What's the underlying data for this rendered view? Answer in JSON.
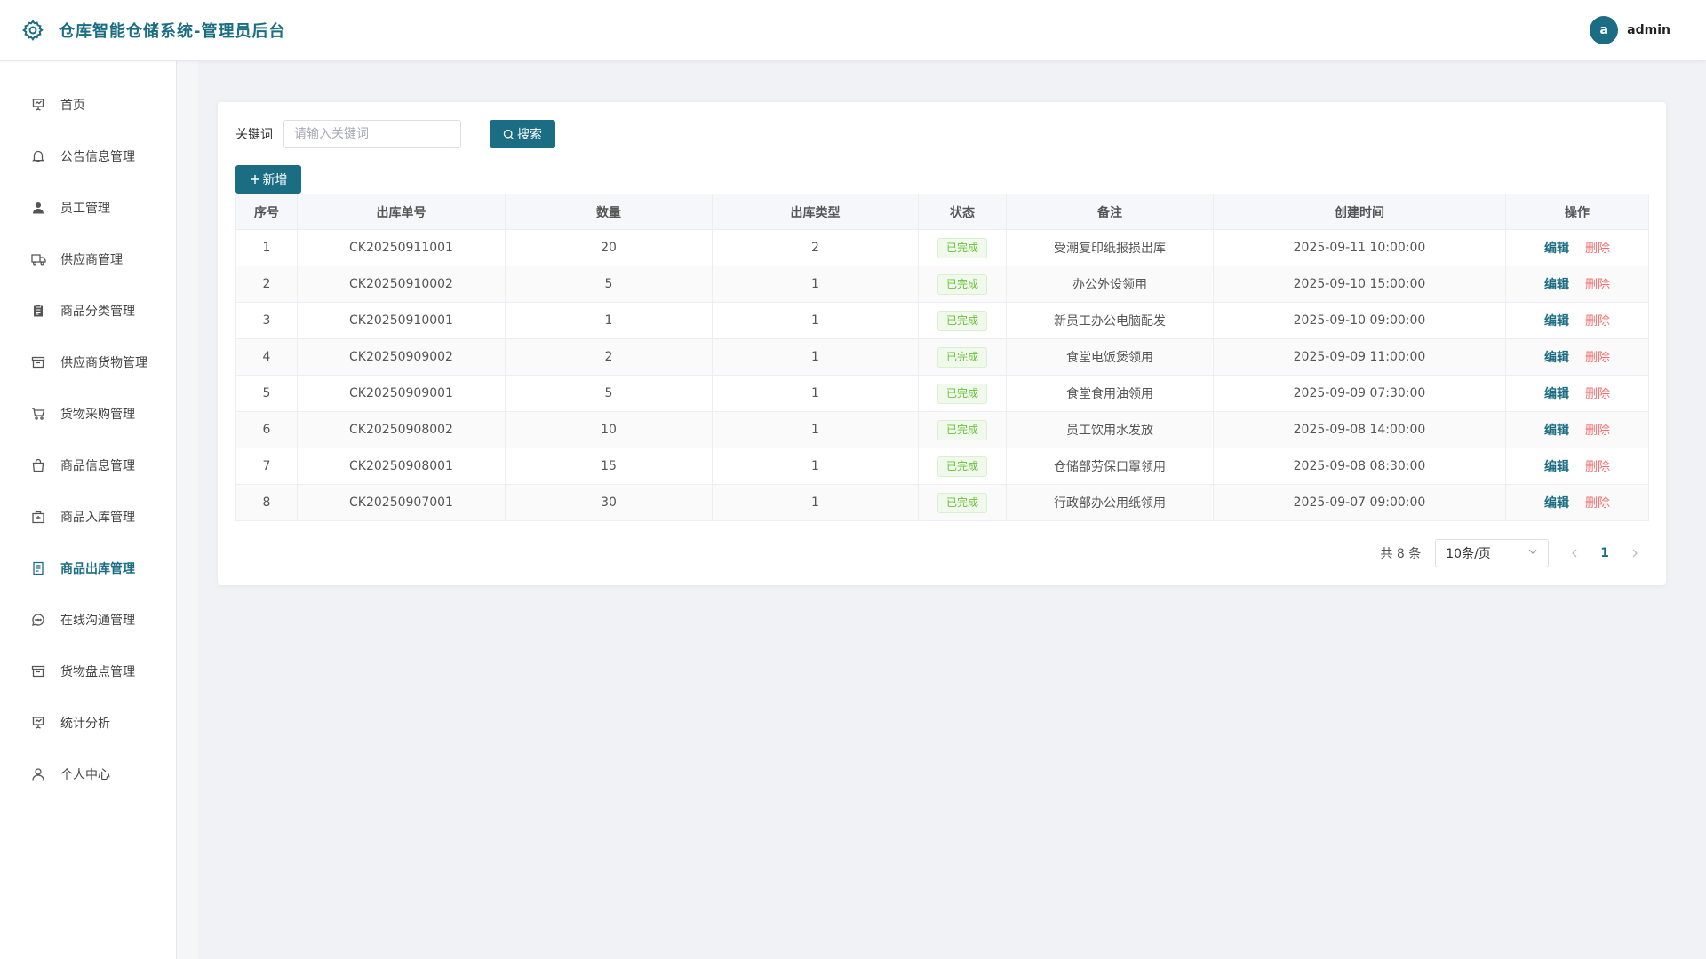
{
  "header": {
    "title": "仓库智能仓储系统-管理员后台",
    "avatar_letter": "a",
    "username": "admin"
  },
  "sidebar": {
    "items": [
      {
        "label": "首页",
        "icon": "presentation-icon"
      },
      {
        "label": "公告信息管理",
        "icon": "bell-icon"
      },
      {
        "label": "员工管理",
        "icon": "user-filled-icon"
      },
      {
        "label": "供应商管理",
        "icon": "truck-icon"
      },
      {
        "label": "商品分类管理",
        "icon": "clipboard-icon"
      },
      {
        "label": "供应商货物管理",
        "icon": "box-icon"
      },
      {
        "label": "货物采购管理",
        "icon": "cart-icon"
      },
      {
        "label": "商品信息管理",
        "icon": "bag-icon"
      },
      {
        "label": "商品入库管理",
        "icon": "inbox-icon"
      },
      {
        "label": "商品出库管理",
        "icon": "document-icon"
      },
      {
        "label": "在线沟通管理",
        "icon": "chat-icon"
      },
      {
        "label": "货物盘点管理",
        "icon": "box-icon"
      },
      {
        "label": "统计分析",
        "icon": "presentation-icon"
      },
      {
        "label": "个人中心",
        "icon": "user-icon"
      }
    ],
    "active_index": 9
  },
  "search": {
    "label": "关键词",
    "placeholder": "请输入关键词",
    "value": "",
    "button_label": "搜索"
  },
  "add_button_label": "新增",
  "table": {
    "columns": [
      "序号",
      "出库单号",
      "数量",
      "出库类型",
      "状态",
      "备注",
      "创建时间",
      "操作"
    ],
    "rows": [
      {
        "index": "1",
        "order_no": "CK20250911001",
        "qty": "20",
        "type": "2",
        "status": "已完成",
        "remark": "受潮复印纸报损出库",
        "created": "2025-09-11 10:00:00"
      },
      {
        "index": "2",
        "order_no": "CK20250910002",
        "qty": "5",
        "type": "1",
        "status": "已完成",
        "remark": "办公外设领用",
        "created": "2025-09-10 15:00:00"
      },
      {
        "index": "3",
        "order_no": "CK20250910001",
        "qty": "1",
        "type": "1",
        "status": "已完成",
        "remark": "新员工办公电脑配发",
        "created": "2025-09-10 09:00:00"
      },
      {
        "index": "4",
        "order_no": "CK20250909002",
        "qty": "2",
        "type": "1",
        "status": "已完成",
        "remark": "食堂电饭煲领用",
        "created": "2025-09-09 11:00:00"
      },
      {
        "index": "5",
        "order_no": "CK20250909001",
        "qty": "5",
        "type": "1",
        "status": "已完成",
        "remark": "食堂食用油领用",
        "created": "2025-09-09 07:30:00"
      },
      {
        "index": "6",
        "order_no": "CK20250908002",
        "qty": "10",
        "type": "1",
        "status": "已完成",
        "remark": "员工饮用水发放",
        "created": "2025-09-08 14:00:00"
      },
      {
        "index": "7",
        "order_no": "CK20250908001",
        "qty": "15",
        "type": "1",
        "status": "已完成",
        "remark": "仓储部劳保口罩领用",
        "created": "2025-09-08 08:30:00"
      },
      {
        "index": "8",
        "order_no": "CK20250907001",
        "qty": "30",
        "type": "1",
        "status": "已完成",
        "remark": "行政部办公用纸领用",
        "created": "2025-09-07 09:00:00"
      }
    ],
    "edit_label": "编辑",
    "delete_label": "删除"
  },
  "pagination": {
    "total_text": "共 8 条",
    "page_size": "10条/页",
    "current_page": "1"
  },
  "colors": {
    "primary": "#1b6d83",
    "success": "#67c23a",
    "danger": "#f56c6c"
  }
}
